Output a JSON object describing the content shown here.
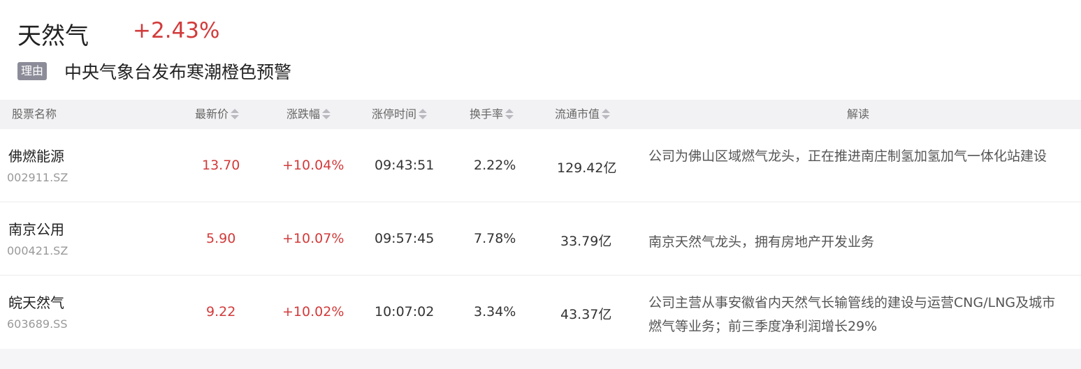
{
  "header": {
    "sector_name": "天然气",
    "sector_change": "+2.43%",
    "reason_tag": "理由",
    "reason_text": "中央气象台发布寒潮橙色预警"
  },
  "table": {
    "columns": [
      "股票名称",
      "最新价",
      "涨跌幅",
      "涨停时间",
      "换手率",
      "流通市值",
      "解读"
    ],
    "rows": [
      {
        "name": "佛燃能源",
        "code": "002911.SZ",
        "price": "13.70",
        "change": "+10.04%",
        "limit_time": "09:43:51",
        "turnover": "2.22%",
        "market_cap": "129.42亿",
        "analysis": "公司为佛山区域燃气龙头，正在推进南庄制氢加氢加气一体化站建设"
      },
      {
        "name": "南京公用",
        "code": "000421.SZ",
        "price": "5.90",
        "change": "+10.07%",
        "limit_time": "09:57:45",
        "turnover": "7.78%",
        "market_cap": "33.79亿",
        "analysis": "南京天然气龙头，拥有房地产开发业务"
      },
      {
        "name": "皖天然气",
        "code": "603689.SS",
        "price": "9.22",
        "change": "+10.02%",
        "limit_time": "10:07:02",
        "turnover": "3.34%",
        "market_cap": "43.37亿",
        "analysis": "公司主营从事安徽省内天然气长输管线的建设与运营CNG/LNG及城市燃气等业务；前三季度净利润增长29%"
      }
    ]
  },
  "colors": {
    "up": "#d23a3a",
    "tag_bg": "#8c8c99",
    "header_bg": "#f2f2f4"
  },
  "icons": {
    "sort": "sort-updown-icon"
  }
}
